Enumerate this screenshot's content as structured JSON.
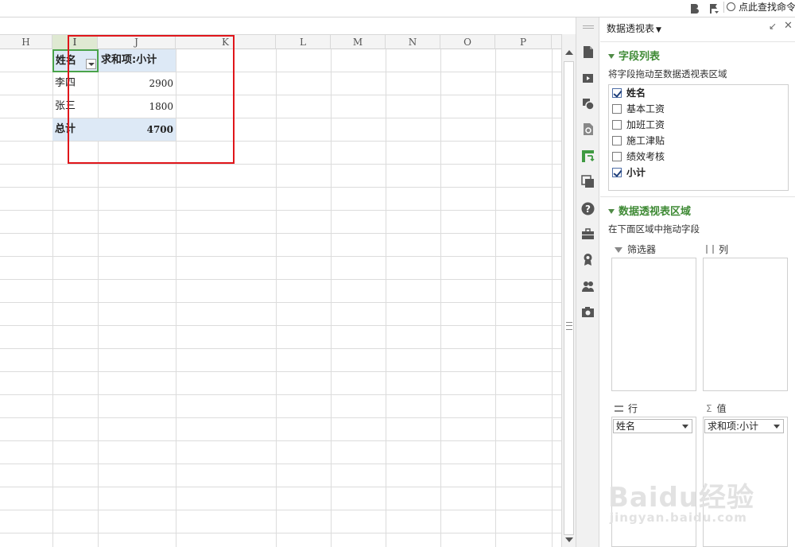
{
  "topbar": {
    "search_label": "点此查找命令"
  },
  "sheet": {
    "columns": [
      "H",
      "I",
      "J",
      "K",
      "L",
      "M",
      "N",
      "O",
      "P"
    ],
    "active_column": "I",
    "pivot": {
      "header_name": "姓名",
      "header_value": "求和项:小计",
      "rows": [
        {
          "name": "李四",
          "value": "2900"
        },
        {
          "name": "张三",
          "value": "1800"
        }
      ],
      "total_label": "总计",
      "total_value": "4700"
    }
  },
  "sidebar_icons": [
    "new-doc-icon",
    "video-icon",
    "shapes-icon",
    "file-search-icon",
    "pivot-table-icon",
    "image-gallery-icon",
    "help-icon",
    "toolbox-icon",
    "award-icon",
    "users-icon",
    "camera-icon"
  ],
  "panel": {
    "title": "数据透视表",
    "field_list_title": "字段列表",
    "field_list_hint": "将字段拖动至数据透视表区域",
    "fields": [
      {
        "label": "姓名",
        "checked": true
      },
      {
        "label": "基本工资",
        "checked": false
      },
      {
        "label": "加班工资",
        "checked": false
      },
      {
        "label": "施工津贴",
        "checked": false
      },
      {
        "label": "绩效考核",
        "checked": false
      },
      {
        "label": "小计",
        "checked": true
      }
    ],
    "areas_title": "数据透视表区域",
    "areas_hint": "在下面区域中拖动字段",
    "filter_label": "筛选器",
    "columns_label": "列",
    "rows_label": "行",
    "values_label": "值",
    "rows_field": "姓名",
    "values_field": "求和项:小计"
  },
  "watermark": {
    "main": "Baidu经验",
    "sub": "jingyan.baidu.com"
  },
  "colors": {
    "pivot_fill": "#dde9f6",
    "highlight_red": "#e0161b",
    "active_cell_green": "#4aa34a",
    "section_green": "#3f8a35"
  }
}
